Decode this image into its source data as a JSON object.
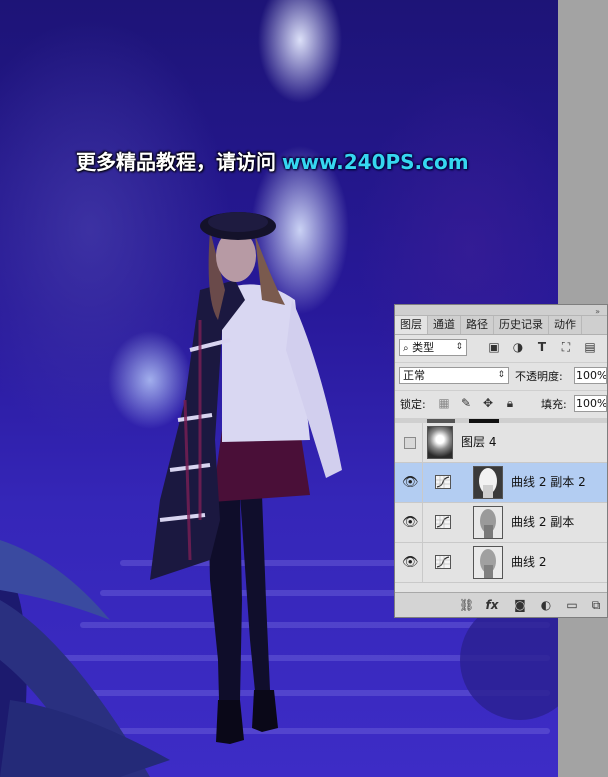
{
  "watermark": {
    "text_cn": "更多精品教程，请访问",
    "url": "www.240PS.com"
  },
  "layers_panel": {
    "tabs": [
      {
        "label": "图层",
        "active": true
      },
      {
        "label": "通道"
      },
      {
        "label": "路径"
      },
      {
        "label": "历史记录"
      },
      {
        "label": "动作"
      }
    ],
    "filter": {
      "kind_label": "类型"
    },
    "blend_mode": "正常",
    "opacity": {
      "label": "不透明度:",
      "value": "100%"
    },
    "lock_label": "锁定:",
    "fill": {
      "label": "填充:",
      "value": "100%"
    },
    "layers": [
      {
        "name": "图层 4",
        "visible": false,
        "type": "pixel",
        "selected": false
      },
      {
        "name": "曲线 2 副本 2",
        "visible": true,
        "type": "curves",
        "selected": true
      },
      {
        "name": "曲线 2 副本",
        "visible": true,
        "type": "curves",
        "selected": false
      },
      {
        "name": "曲线 2",
        "visible": true,
        "type": "curves",
        "selected": false
      }
    ],
    "footer_icons": [
      "link-icon",
      "fx-icon",
      "mask-icon",
      "adjustment-icon",
      "folder-icon",
      "new-layer-icon"
    ]
  },
  "colors": {
    "selected_row": "#b3cdf2",
    "watermark_url": "#36d7f0"
  }
}
